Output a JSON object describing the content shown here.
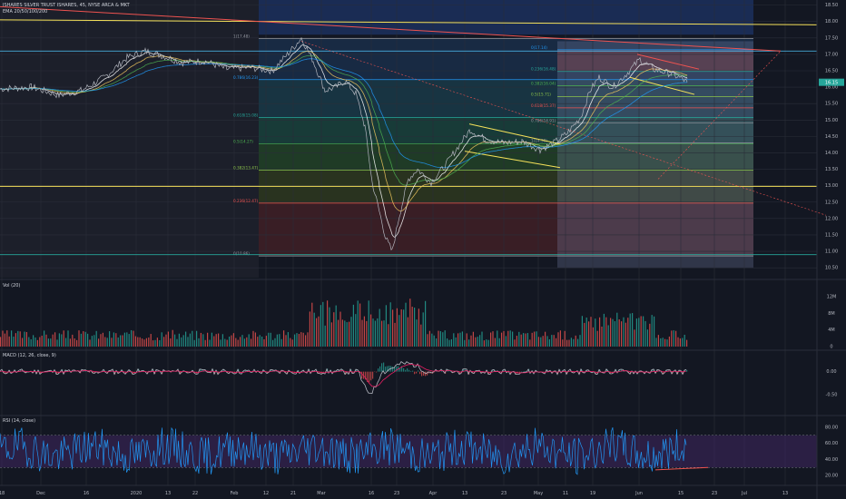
{
  "header": {
    "symbol_line": "ISHARES SILVER TRUST ISHARES, 45, NYSE ARCA & MKT",
    "ema_line": "EMA 20/50/100/200"
  },
  "panes": {
    "vol_label": "Vol (20)",
    "macd_label": "MACD (12, 26, close, 9)",
    "rsi_label": "RSI (14, close)"
  },
  "chart_data": [
    {
      "type": "line",
      "name": "price",
      "title": "ISHARES SILVER TRUST ISHARES, 45, NYSE ARCA & MKT",
      "x_ticks": [
        "18",
        "Dec",
        "16",
        "2020",
        "13",
        "22",
        "Feb",
        "12",
        "21",
        "Mar",
        "16",
        "23",
        "Apr",
        "13",
        "23",
        "May",
        "11",
        "19",
        "Jun",
        "15",
        "23",
        "Jul",
        "13"
      ],
      "y_ticks": [
        "10.50",
        "11.00",
        "11.50",
        "12.00",
        "12.50",
        "13.00",
        "13.50",
        "14.00",
        "14.50",
        "15.00",
        "15.50",
        "16.00",
        "16.50",
        "17.00",
        "17.50",
        "18.00",
        "18.50"
      ],
      "ylim": [
        10.2,
        18.6
      ],
      "last_price": "16.15",
      "path": [
        [
          0,
          15.95
        ],
        [
          35,
          16.0
        ],
        [
          65,
          15.75
        ],
        [
          90,
          15.9
        ],
        [
          115,
          16.3
        ],
        [
          140,
          16.9
        ],
        [
          160,
          17.1
        ],
        [
          180,
          16.95
        ],
        [
          200,
          16.75
        ],
        [
          225,
          16.8
        ],
        [
          250,
          16.55
        ],
        [
          275,
          16.6
        ],
        [
          300,
          16.5
        ],
        [
          320,
          17.1
        ],
        [
          332,
          17.5
        ],
        [
          345,
          16.8
        ],
        [
          358,
          15.9
        ],
        [
          370,
          16.0
        ],
        [
          380,
          16.2
        ],
        [
          392,
          15.8
        ],
        [
          402,
          14.8
        ],
        [
          410,
          13.1
        ],
        [
          418,
          12.2
        ],
        [
          425,
          11.4
        ],
        [
          432,
          11.0
        ],
        [
          440,
          12.1
        ],
        [
          450,
          13.2
        ],
        [
          460,
          13.5
        ],
        [
          475,
          13.1
        ],
        [
          490,
          13.6
        ],
        [
          505,
          14.2
        ],
        [
          518,
          14.7
        ],
        [
          535,
          14.4
        ],
        [
          555,
          14.3
        ],
        [
          575,
          14.35
        ],
        [
          595,
          14.1
        ],
        [
          610,
          14.3
        ],
        [
          625,
          14.6
        ],
        [
          640,
          15.1
        ],
        [
          650,
          15.9
        ],
        [
          660,
          16.3
        ],
        [
          675,
          16.0
        ],
        [
          690,
          16.4
        ],
        [
          705,
          16.85
        ],
        [
          720,
          16.55
        ],
        [
          740,
          16.4
        ],
        [
          752,
          16.25
        ],
        [
          757,
          16.15
        ]
      ],
      "fib_levels": [
        {
          "ratio": "1",
          "value": "(17.48)",
          "price": 17.48
        },
        {
          "ratio": "0.786",
          "value": "(16.23)",
          "price": 16.23
        },
        {
          "ratio": "0.618",
          "value": "(15.08)",
          "price": 15.08
        },
        {
          "ratio": "0.5",
          "value": "(14.27)",
          "price": 14.27
        },
        {
          "ratio": "0.382",
          "value": "(13.47)",
          "price": 13.47
        },
        {
          "ratio": "0.236",
          "value": "(12.47)",
          "price": 12.47
        },
        {
          "ratio": "0",
          "value": "(10.86)",
          "price": 10.86
        }
      ],
      "fib_levels_2": [
        {
          "ratio": "0",
          "value": "(17.14)",
          "price": 17.14
        },
        {
          "ratio": "0.236",
          "value": "(16.48)",
          "price": 16.48
        },
        {
          "ratio": "0.382",
          "value": "(16.04)",
          "price": 16.04
        },
        {
          "ratio": "0.5",
          "value": "(15.71)",
          "price": 15.71
        },
        {
          "ratio": "0.618",
          "value": "(15.37)",
          "price": 15.37
        },
        {
          "ratio": "0.786",
          "value": "(14.91)",
          "price": 14.91
        },
        {
          "ratio": "1",
          "value": "(14.30)",
          "price": 14.3
        }
      ],
      "horizontal_lines": [
        17.1,
        12.98,
        10.9
      ],
      "colors": {
        "price": "#b2b5be",
        "ema1": "#ffffff",
        "ema2": "#f0c75e",
        "ema3": "#4caf50",
        "ema4": "#2196f3",
        "resistance": "#ef5350",
        "trend": "#f5e15a"
      }
    },
    {
      "type": "bar",
      "name": "volume",
      "y_ticks": [
        "0",
        "4M",
        "8M",
        "12M"
      ],
      "ylim": [
        0,
        14
      ]
    },
    {
      "type": "line",
      "name": "macd",
      "y_ticks": [
        "0.00",
        "-0.50"
      ],
      "ylim": [
        -0.9,
        0.35
      ]
    },
    {
      "type": "line",
      "name": "rsi",
      "y_ticks": [
        "20.00",
        "40.00",
        "60.00",
        "80.00"
      ],
      "ylim": [
        10,
        90
      ],
      "bands": [
        30,
        70
      ]
    }
  ]
}
